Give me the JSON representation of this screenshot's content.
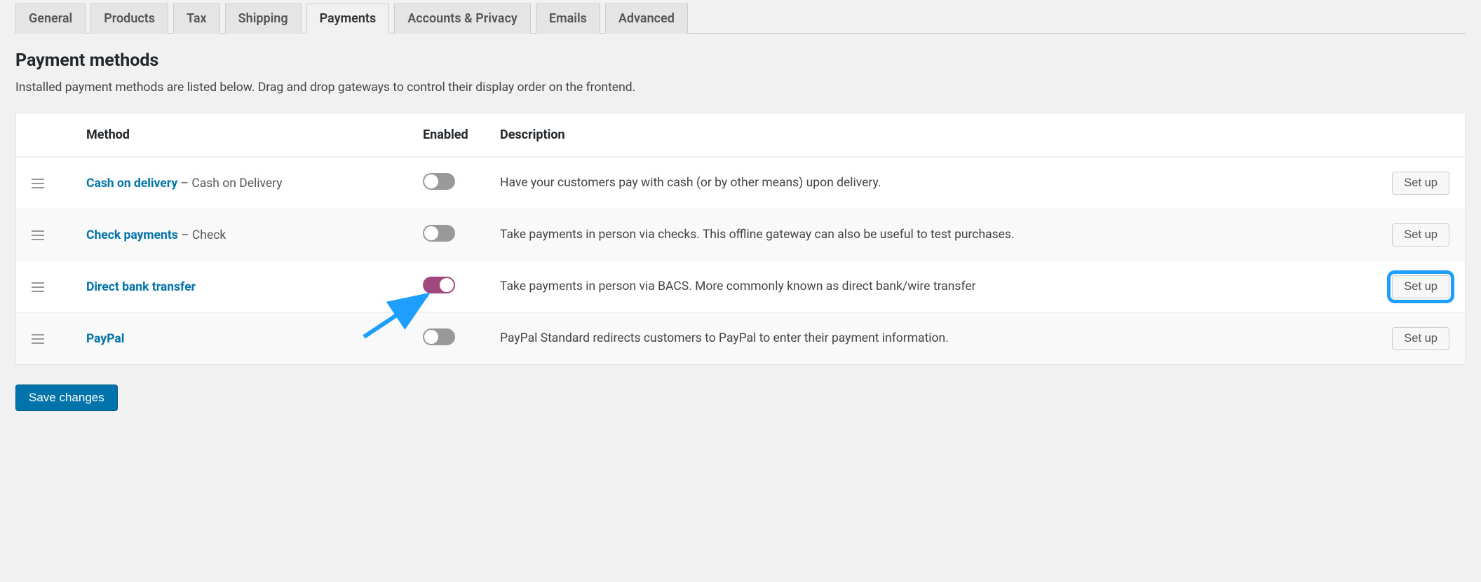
{
  "tabs": [
    {
      "label": "General",
      "active": false
    },
    {
      "label": "Products",
      "active": false
    },
    {
      "label": "Tax",
      "active": false
    },
    {
      "label": "Shipping",
      "active": false
    },
    {
      "label": "Payments",
      "active": true
    },
    {
      "label": "Accounts & Privacy",
      "active": false
    },
    {
      "label": "Emails",
      "active": false
    },
    {
      "label": "Advanced",
      "active": false
    }
  ],
  "section": {
    "title": "Payment methods",
    "description": "Installed payment methods are listed below. Drag and drop gateways to control their display order on the frontend."
  },
  "table": {
    "headers": {
      "method": "Method",
      "enabled": "Enabled",
      "description": "Description"
    },
    "rows": [
      {
        "name": "Cash on delivery",
        "sub": "Cash on Delivery",
        "enabled": false,
        "description": "Have your customers pay with cash (or by other means) upon delivery.",
        "action": "Set up",
        "highlight": false
      },
      {
        "name": "Check payments",
        "sub": "Check",
        "enabled": false,
        "description": "Take payments in person via checks. This offline gateway can also be useful to test purchases.",
        "action": "Set up",
        "highlight": false
      },
      {
        "name": "Direct bank transfer",
        "sub": "",
        "enabled": true,
        "description": "Take payments in person via BACS. More commonly known as direct bank/wire transfer",
        "action": "Set up",
        "highlight": true
      },
      {
        "name": "PayPal",
        "sub": "",
        "enabled": false,
        "description": "PayPal Standard redirects customers to PayPal to enter their payment information.",
        "action": "Set up",
        "highlight": false
      }
    ]
  },
  "buttons": {
    "save": "Save changes"
  },
  "colors": {
    "link": "#0073aa",
    "toggle_on": "#a0477d",
    "highlight": "#1e9fff"
  }
}
